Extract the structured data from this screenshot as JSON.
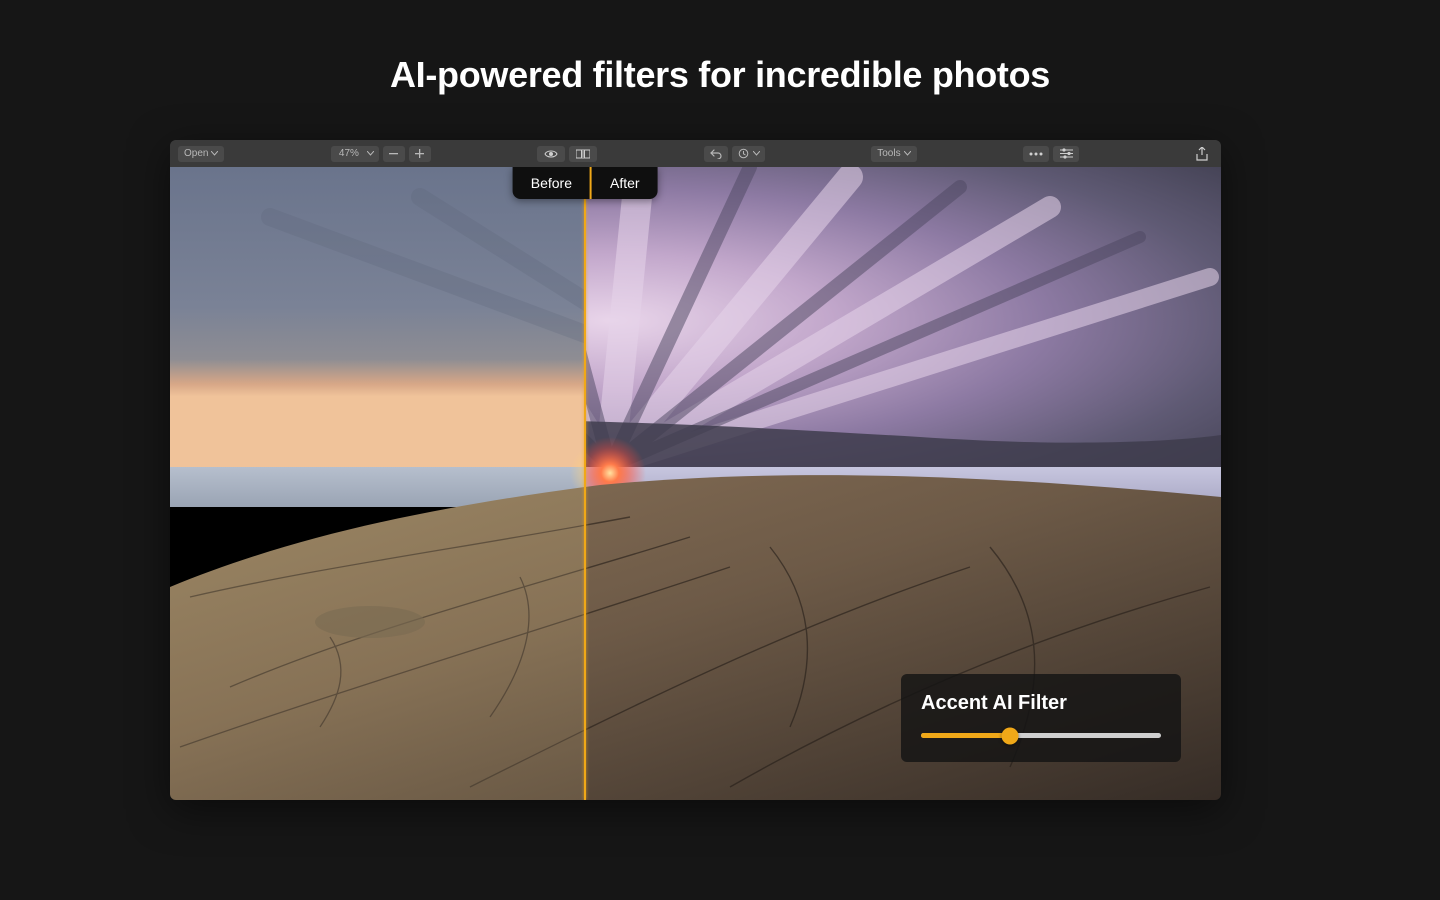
{
  "hero": {
    "title": "AI-powered filters for incredible photos"
  },
  "toolbar": {
    "open_label": "Open",
    "zoom_value": "47%",
    "tools_label": "Tools"
  },
  "compare": {
    "before_label": "Before",
    "after_label": "After",
    "split_percent": 39.5
  },
  "filter_panel": {
    "title": "Accent AI Filter",
    "slider_percent": 37
  },
  "colors": {
    "accent": "#f0a818",
    "toolbar_bg": "#3a3a3a",
    "button_bg": "#4a4a4a"
  }
}
